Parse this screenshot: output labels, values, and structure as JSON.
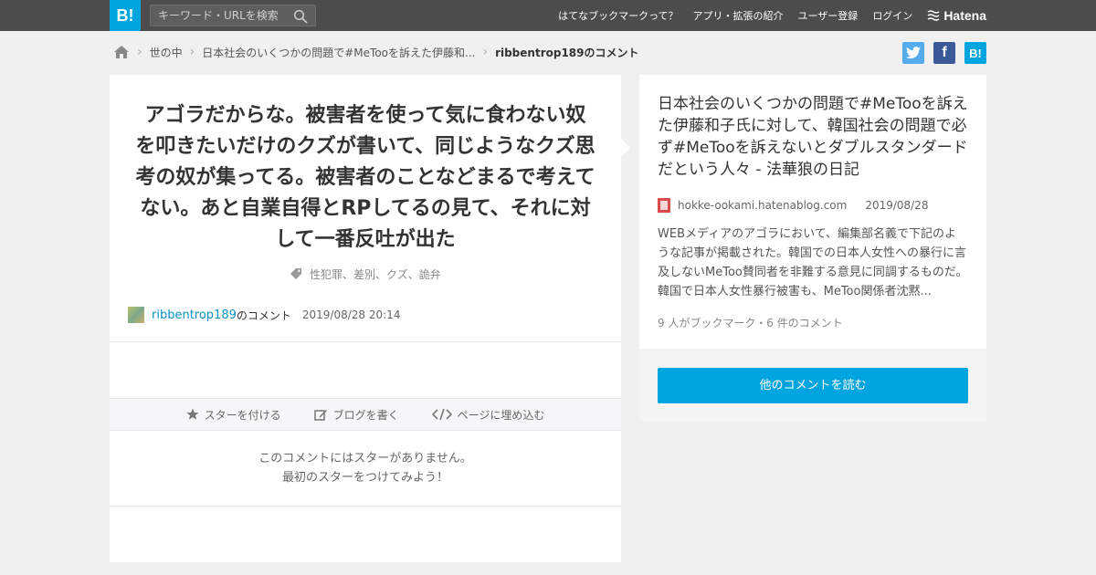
{
  "header": {
    "logo": "B!",
    "search_placeholder": "キーワード・URLを検索",
    "nav": [
      "はてなブックマークって？",
      "アプリ・拡張の紹介",
      "ユーザー登録",
      "ログイン"
    ],
    "brand": "Hatena"
  },
  "breadcrumb": {
    "category": "世の中",
    "entry": "日本社会のいくつかの問題で#MeTooを訴えた伊藤和...",
    "current": "ribbentrop189のコメント"
  },
  "share": {
    "twitter_color": "#55acee",
    "facebook_color": "#3b5998",
    "hatena_color": "#00a4de",
    "hatena_label": "B!"
  },
  "comment": {
    "text": "アゴラだからな。被害者を使って気に食わない奴を叩きたいだけのクズが書いて、同じようなクズ思考の奴が集ってる。被害者のことなどまるで考えてない。あと自業自得とRPしてるの見て、それに対して一番反吐が出た",
    "tags": "性犯罪、差別、クズ、詭弁",
    "user": "ribbentrop189",
    "suffix": "のコメント",
    "time": "2019/08/28 20:14"
  },
  "actions": {
    "star": "スターを付ける",
    "blog": "ブログを書く",
    "embed": "ページに埋め込む"
  },
  "nostar": {
    "line1": "このコメントにはスターがありません。",
    "line2": "最初のスターをつけてみよう！"
  },
  "entry": {
    "title": "日本社会のいくつかの問題で#MeTooを訴えた伊藤和子氏に対して、韓国社会の問題で必ず#MeTooを訴えないとダブルスタンダードだという人々 - 法華狼の日記",
    "domain": "hokke-ookami.hatenablog.com",
    "date": "2019/08/28",
    "description": "WEBメディアのアゴラにおいて、編集部名義で下記のような記事が掲載された。韓国での日本人女性への暴行に言及しないMeToo賛同者を非難する意見に同調するものだ。韓国で日本人女性暴行被害も、MeToo関係者沈黙...",
    "count": "9 人がブックマーク・6 件のコメント",
    "read_more": "他のコメントを読む"
  },
  "colors": {
    "accent": "#00a4de",
    "topbar": "#4c4c4c",
    "link": "#0a91c4"
  }
}
